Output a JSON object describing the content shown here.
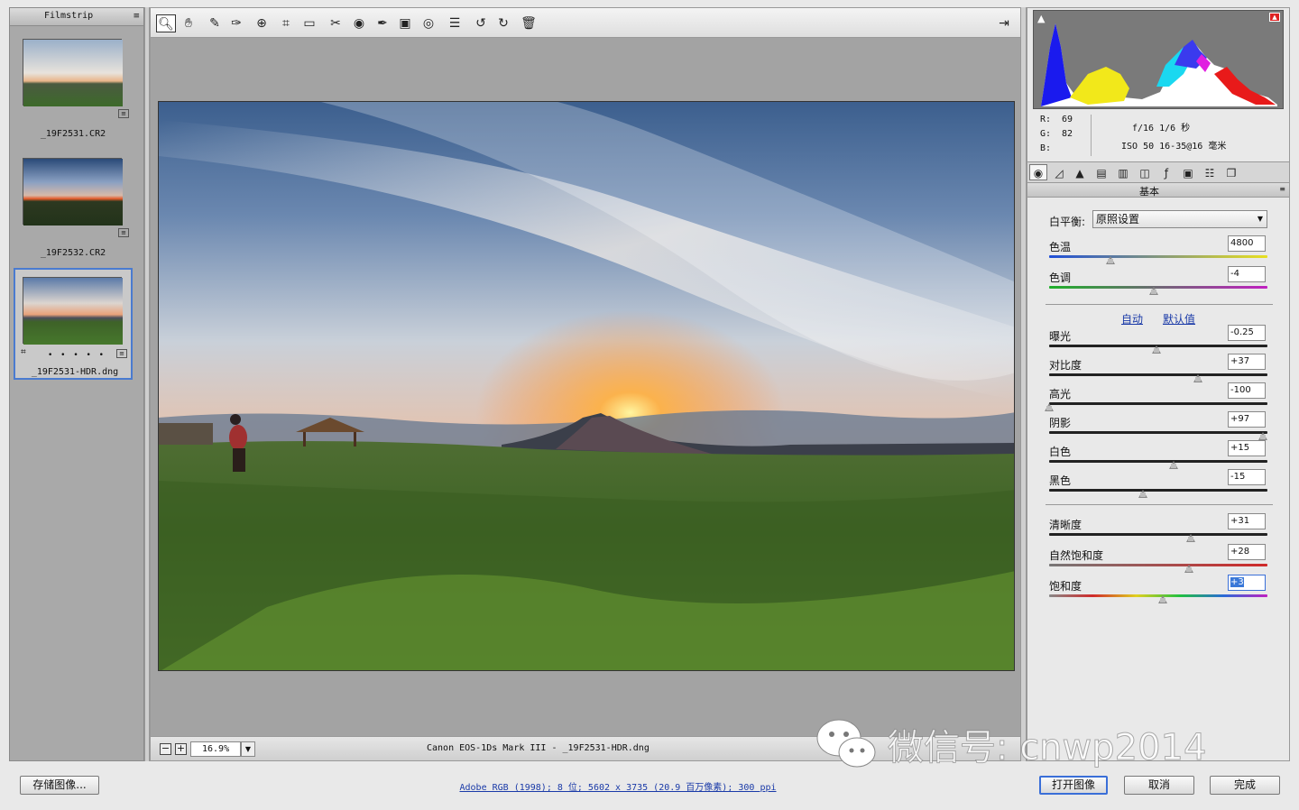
{
  "filmstrip": {
    "title": "Filmstrip",
    "menu_icon": "≡",
    "items": [
      {
        "name": "_19F2531.CR2",
        "selected": false
      },
      {
        "name": "_19F2532.CR2",
        "selected": false
      },
      {
        "name": "_19F2531-HDR.dng",
        "selected": true,
        "dots": "• • • • •"
      }
    ]
  },
  "toolbar": {
    "tools": [
      "zoom-icon",
      "hand-icon",
      "white-balance-icon",
      "color-sampler-icon",
      "target-adjust-icon",
      "crop-icon",
      "straighten-icon",
      "spot-removal-icon",
      "red-eye-icon",
      "adjustment-brush-icon",
      "graduated-filter-icon",
      "radial-filter-icon",
      "list-icon",
      "rotate-left-icon",
      "rotate-right-icon",
      "trash-icon"
    ],
    "fullscreen_icon": "fullscreen-icon"
  },
  "status": {
    "zoom_minus": "−",
    "zoom_plus": "+",
    "zoom": "16.9%",
    "camera": "Canon EOS-1Ds Mark III -  _19F2531-HDR.dng"
  },
  "histogram": {
    "r_label": "R:",
    "r_value": "69",
    "g_label": "G:",
    "g_value": "82",
    "b_label": "B:",
    "b_value": "",
    "aperture_shutter": "f/16   1/6 秒",
    "iso_lens": "ISO 50   16-35@16 毫米"
  },
  "panel": {
    "title": "基本",
    "wb_label": "白平衡:",
    "wb_value": "原照设置",
    "auto": "自动",
    "default": "默认值",
    "sliders": [
      {
        "label": "色温",
        "value": "4800",
        "pos": 0.28
      },
      {
        "label": "色调",
        "value": "-4",
        "pos": 0.48
      },
      {
        "label": "曝光",
        "value": "-0.25",
        "pos": 0.49
      },
      {
        "label": "对比度",
        "value": "+37",
        "pos": 0.68
      },
      {
        "label": "高光",
        "value": "-100",
        "pos": 0.0
      },
      {
        "label": "阴影",
        "value": "+97",
        "pos": 0.98
      },
      {
        "label": "白色",
        "value": "+15",
        "pos": 0.57
      },
      {
        "label": "黑色",
        "value": "-15",
        "pos": 0.43
      },
      {
        "label": "清晰度",
        "value": "+31",
        "pos": 0.65
      },
      {
        "label": "自然饱和度",
        "value": "+28",
        "pos": 0.64
      },
      {
        "label": "饱和度",
        "value": "+3",
        "pos": 0.52
      }
    ]
  },
  "bottom": {
    "save": "存储图像...",
    "workflow": "Adobe RGB (1998); 8 位; 5602 x 3735 (20.9 百万像素); 300 ppi",
    "open": "打开图像",
    "cancel": "取消",
    "done": "完成"
  },
  "watermark": "微信号: cnwp2014"
}
